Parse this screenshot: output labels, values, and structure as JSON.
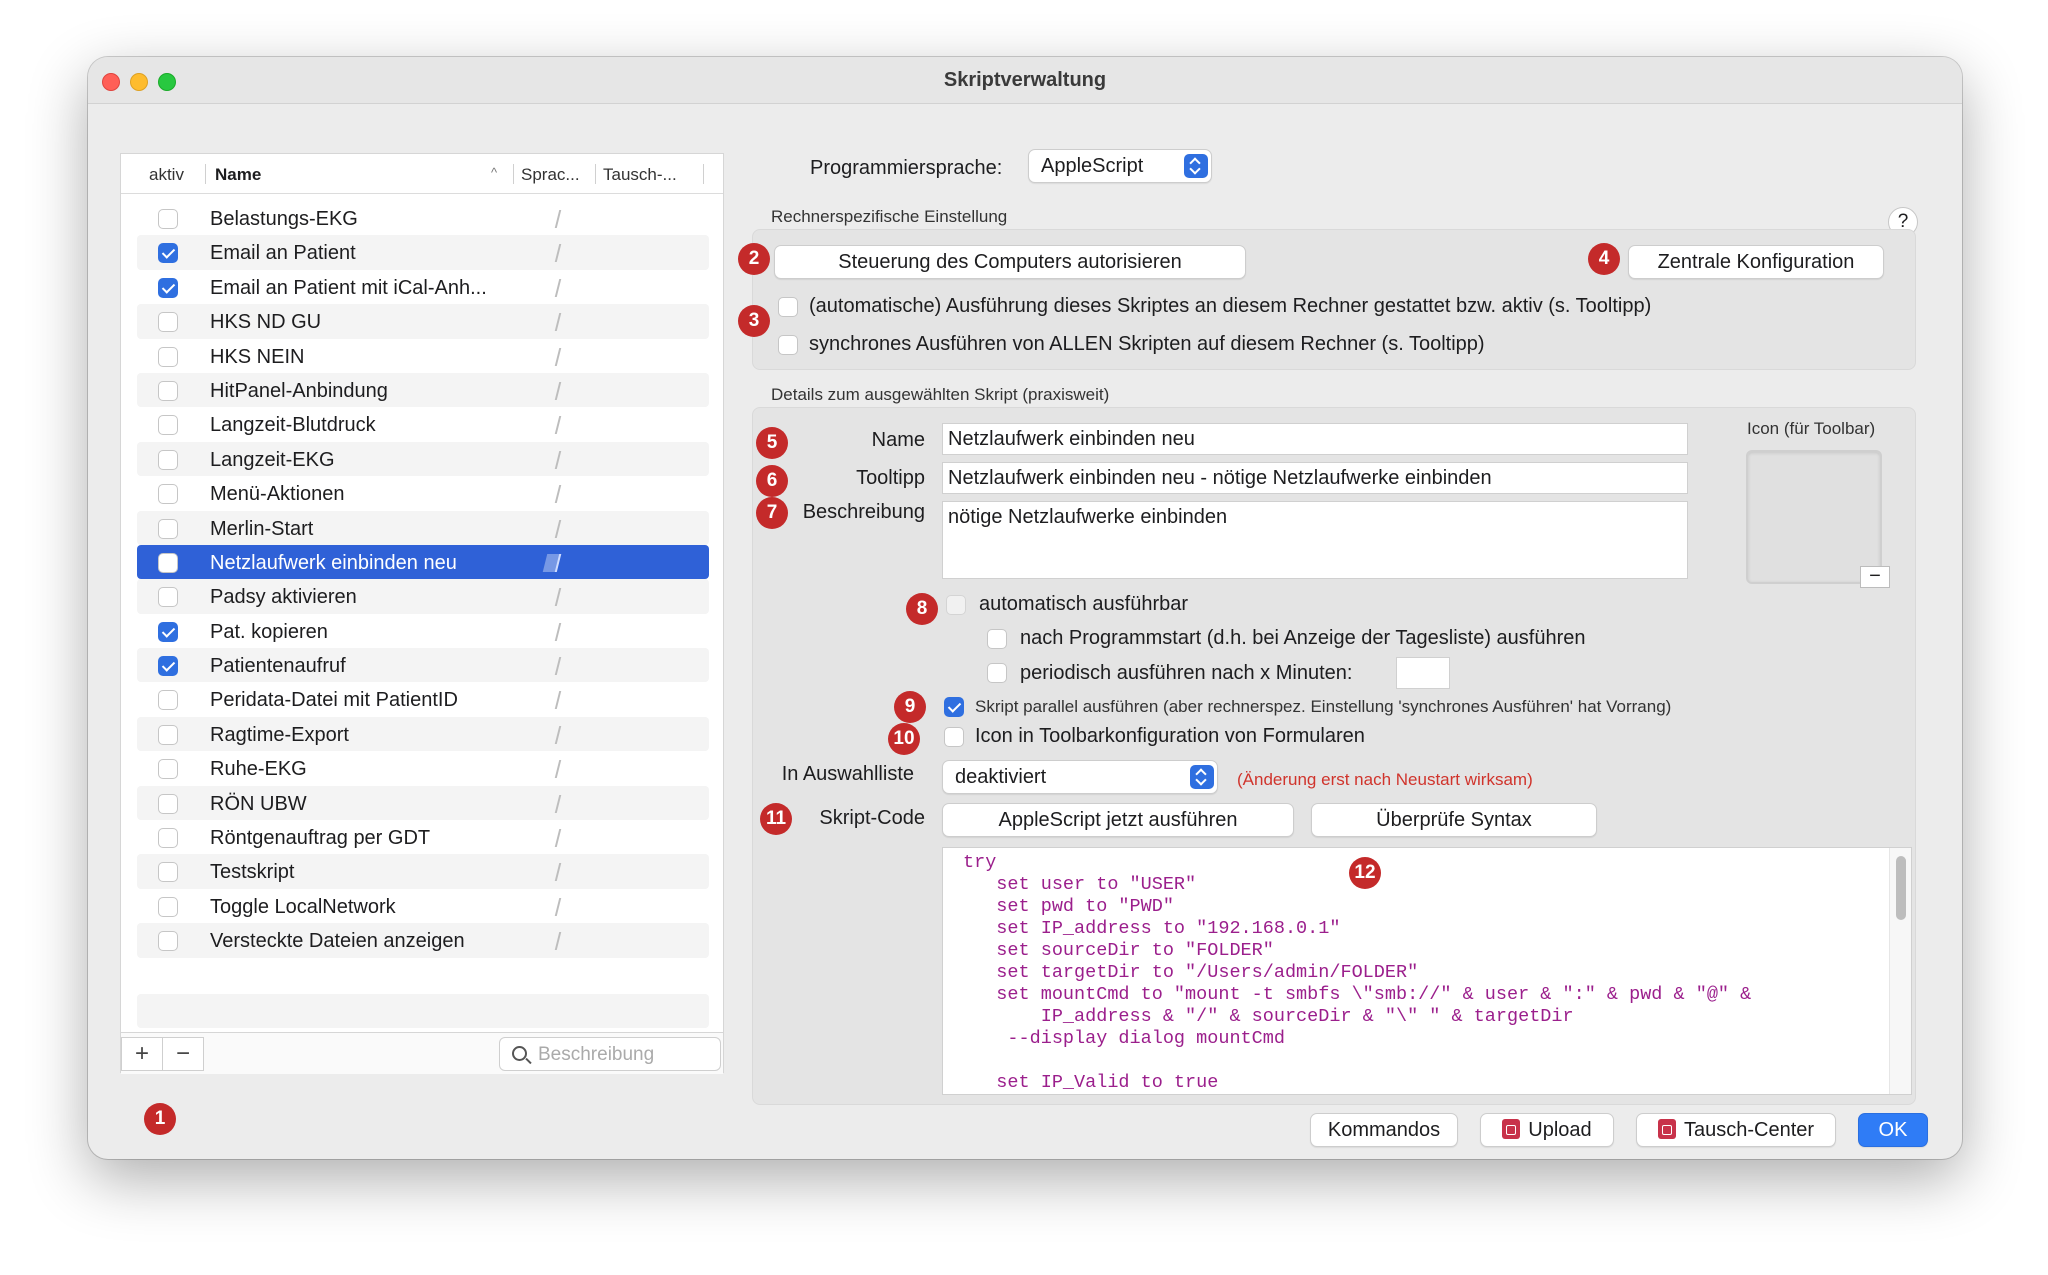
{
  "window": {
    "title": "Skriptverwaltung"
  },
  "list": {
    "columns": {
      "active": "aktiv",
      "name": "Name",
      "language": "Sprac...",
      "exchange": "Tausch-..."
    },
    "rows": [
      {
        "name": "Belastungs-EKG",
        "checked": false
      },
      {
        "name": "Email an Patient",
        "checked": true
      },
      {
        "name": "Email an Patient mit iCal-Anh...",
        "checked": true
      },
      {
        "name": "HKS ND GU",
        "checked": false
      },
      {
        "name": "HKS NEIN",
        "checked": false
      },
      {
        "name": "HitPanel-Anbindung",
        "checked": false
      },
      {
        "name": "Langzeit-Blutdruck",
        "checked": false
      },
      {
        "name": "Langzeit-EKG",
        "checked": false
      },
      {
        "name": "Menü-Aktionen",
        "checked": false
      },
      {
        "name": "Merlin-Start",
        "checked": false
      },
      {
        "name": "Netzlaufwerk einbinden neu",
        "checked": false,
        "selected": true
      },
      {
        "name": "Padsy aktivieren",
        "checked": false
      },
      {
        "name": "Pat. kopieren",
        "checked": true
      },
      {
        "name": "Patientenaufruf",
        "checked": true
      },
      {
        "name": "Peridata-Datei mit PatientID",
        "checked": false
      },
      {
        "name": "Ragtime-Export",
        "checked": false
      },
      {
        "name": "Ruhe-EKG",
        "checked": false
      },
      {
        "name": "RÖN UBW",
        "checked": false
      },
      {
        "name": "Röntgenauftrag per GDT",
        "checked": false
      },
      {
        "name": "Testskript",
        "checked": false
      },
      {
        "name": "Toggle LocalNetwork",
        "checked": false
      },
      {
        "name": "Versteckte Dateien anzeigen",
        "checked": false
      }
    ],
    "add_label": "+",
    "remove_label": "−",
    "search_placeholder": "Beschreibung"
  },
  "language": {
    "label": "Programmiersprache:",
    "value": "AppleScript"
  },
  "machine": {
    "section_label": "Rechnerspezifische Einstellung",
    "help_label": "?",
    "authorize_button": "Steuerung des Computers autorisieren",
    "central_config_button": "Zentrale Konfiguration",
    "auto_exec_label": "(automatische) Ausführung dieses Skriptes an diesem Rechner gestattet bzw. aktiv (s. Tooltipp)",
    "sync_exec_label": "synchrones Ausführen von ALLEN Skripten auf diesem Rechner (s. Tooltipp)"
  },
  "details": {
    "section_label": "Details zum ausgewählten Skript (praxisweit)",
    "name_label": "Name",
    "name_value": "Netzlaufwerk einbinden neu",
    "tooltip_label": "Tooltipp",
    "tooltip_value": "Netzlaufwerk einbinden neu - nötige Netzlaufwerke einbinden",
    "description_label": "Beschreibung",
    "description_value": "nötige Netzlaufwerke einbinden",
    "icon_label": "Icon (für Toolbar)",
    "icon_remove": "−",
    "auto_exec_label": "automatisch ausführbar",
    "after_start_label": "nach Programmstart (d.h. bei Anzeige der Tagesliste) ausführen",
    "periodic_label": "periodisch ausführen nach x Minuten:",
    "periodic_value": "",
    "parallel_label": "Skript parallel ausführen (aber rechnerspez. Einstellung 'synchrones Ausführen' hat Vorrang)",
    "toolbar_label": "Icon in Toolbarkonfiguration von Formularen",
    "selection_list_label": "In Auswahlliste",
    "selection_list_value": "deaktiviert",
    "restart_note": "(Änderung erst nach Neustart wirksam)",
    "code_label": "Skript-Code",
    "run_button": "AppleScript jetzt ausführen",
    "check_button": "Überprüfe Syntax"
  },
  "code_lines": [
    "try",
    "   set user to \"USER\"",
    "   set pwd to \"PWD\"",
    "   set IP_address to \"192.168.0.1\"",
    "   set sourceDir to \"FOLDER\"",
    "   set targetDir to \"/Users/admin/FOLDER\"",
    "   set mountCmd to \"mount -t smbfs \\\"smb://\" & user & \":\" & pwd & \"@\" &",
    "       IP_address & \"/\" & sourceDir & \"\\\" \" & targetDir",
    "    --display dialog mountCmd",
    "",
    "   set IP_Valid to true"
  ],
  "footer": {
    "commands_button": "Kommandos",
    "upload_button": "Upload",
    "exchange_button": "Tausch-Center",
    "ok_button": "OK"
  },
  "badges": [
    "1",
    "2",
    "3",
    "4",
    "5",
    "6",
    "7",
    "8",
    "9",
    "10",
    "11",
    "12"
  ],
  "colors": {
    "selection": "#2f61d7",
    "badge": "#c42a2a",
    "accent": "#2f7cf6",
    "warning": "#d0342c",
    "code": "#9b1f8c"
  }
}
